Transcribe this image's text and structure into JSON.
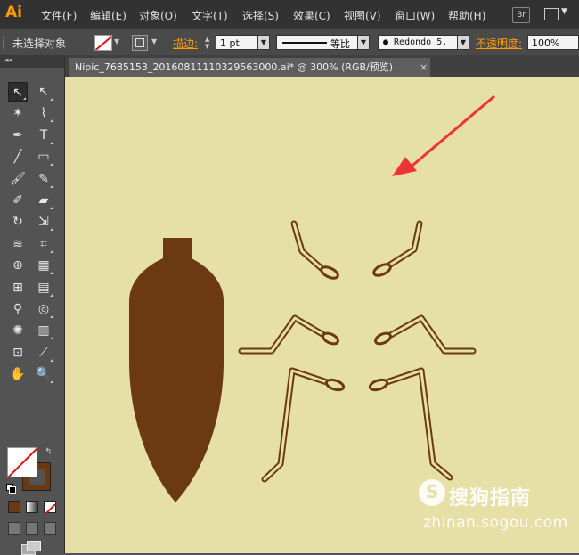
{
  "app": {
    "logo": "Ai"
  },
  "menu": [
    "文件(F)",
    "编辑(E)",
    "对象(O)",
    "文字(T)",
    "选择(S)",
    "效果(C)",
    "视图(V)",
    "窗口(W)",
    "帮助(H)"
  ],
  "menu_right": {
    "bridge": "Br",
    "workspace_arrow": "▼"
  },
  "control_bar": {
    "selection": "未选择对象",
    "stroke_label": "描边:",
    "stroke_weight": "1 pt",
    "profile_label": "等比",
    "brush": "● Redondo 5.",
    "opacity_label": "不透明度:",
    "opacity_value": "100%",
    "dropdown_arrow": "▼"
  },
  "panel_header": "◂◂",
  "tools": [
    {
      "name": "selection-tool-icon",
      "glyph": "↖"
    },
    {
      "name": "direct-selection-tool-icon",
      "glyph": "↖"
    },
    {
      "name": "magic-wand-tool-icon",
      "glyph": "✶"
    },
    {
      "name": "lasso-tool-icon",
      "glyph": "⌇"
    },
    {
      "name": "pen-tool-icon",
      "glyph": "✒"
    },
    {
      "name": "type-tool-icon",
      "glyph": "T"
    },
    {
      "name": "line-segment-tool-icon",
      "glyph": "╱"
    },
    {
      "name": "rectangle-tool-icon",
      "glyph": "▭"
    },
    {
      "name": "paintbrush-tool-icon",
      "glyph": "🖌"
    },
    {
      "name": "pencil-tool-icon",
      "glyph": "✎"
    },
    {
      "name": "blob-brush-tool-icon",
      "glyph": "✐"
    },
    {
      "name": "eraser-tool-icon",
      "glyph": "▰"
    },
    {
      "name": "rotate-tool-icon",
      "glyph": "↻"
    },
    {
      "name": "scale-tool-icon",
      "glyph": "⇲"
    },
    {
      "name": "warp-tool-icon",
      "glyph": "≋"
    },
    {
      "name": "free-transform-tool-icon",
      "glyph": "⌗"
    },
    {
      "name": "shape-builder-tool-icon",
      "glyph": "⊕"
    },
    {
      "name": "perspective-grid-tool-icon",
      "glyph": "▦"
    },
    {
      "name": "mesh-tool-icon",
      "glyph": "⊞"
    },
    {
      "name": "gradient-tool-icon",
      "glyph": "▤"
    },
    {
      "name": "eyedropper-tool-icon",
      "glyph": "⚲"
    },
    {
      "name": "blend-tool-icon",
      "glyph": "◎"
    },
    {
      "name": "symbol-sprayer-tool-icon",
      "glyph": "✺"
    },
    {
      "name": "column-graph-tool-icon",
      "glyph": "▥"
    },
    {
      "name": "artboard-tool-icon",
      "glyph": "⊡"
    },
    {
      "name": "slice-tool-icon",
      "glyph": "⟋"
    },
    {
      "name": "hand-tool-icon",
      "glyph": "✋"
    },
    {
      "name": "zoom-tool-icon",
      "glyph": "🔍"
    }
  ],
  "swap_glyph": "↰",
  "document_tab": {
    "title": "Nipic_7685153_20160811110329563000.ai* @ 300% (RGB/预览)",
    "close": "×"
  },
  "colors": {
    "canvas_bg": "#e6dfa6",
    "shape_brown": "#6b3a12",
    "arrow_red": "#ee3333"
  },
  "watermark": {
    "text": "搜狗指南",
    "url": "zhinan.sogou.com"
  }
}
